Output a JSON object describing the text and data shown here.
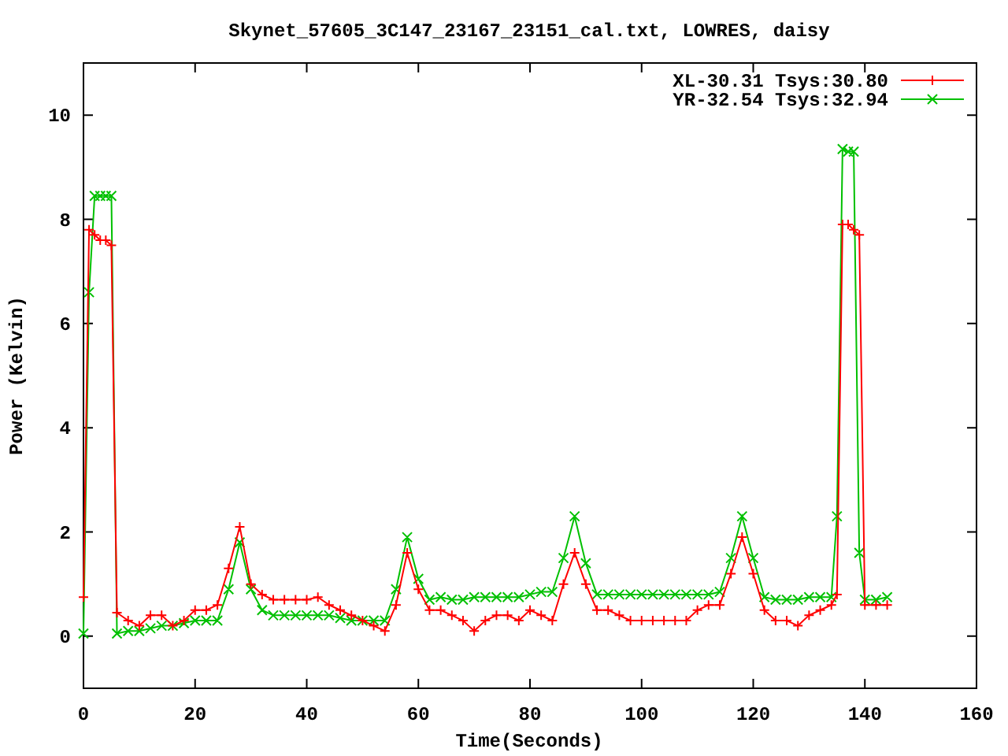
{
  "chart_data": {
    "type": "line",
    "title": "Skynet_57605_3C147_23167_23151_cal.txt, LOWRES, daisy",
    "xlabel": "Time(Seconds)",
    "ylabel": "Power (Kelvin)",
    "x": [
      0,
      1,
      2,
      3,
      4,
      5,
      6,
      8,
      10,
      12,
      14,
      16,
      18,
      20,
      22,
      24,
      26,
      28,
      30,
      32,
      34,
      36,
      38,
      40,
      42,
      44,
      46,
      48,
      50,
      52,
      54,
      56,
      58,
      60,
      62,
      64,
      66,
      68,
      70,
      72,
      74,
      76,
      78,
      80,
      82,
      84,
      86,
      88,
      90,
      92,
      94,
      96,
      98,
      100,
      102,
      104,
      106,
      108,
      110,
      112,
      114,
      116,
      118,
      120,
      122,
      124,
      126,
      128,
      130,
      132,
      134,
      135,
      136,
      137,
      138,
      139,
      140,
      142,
      144
    ],
    "series": [
      {
        "name": "XL-30.31 Tsys:30.80",
        "color": "#ff0000",
        "marker": "plus",
        "values": [
          0.75,
          7.8,
          7.7,
          7.6,
          7.6,
          7.5,
          0.45,
          0.3,
          0.2,
          0.4,
          0.4,
          0.2,
          0.3,
          0.5,
          0.5,
          0.6,
          1.3,
          2.1,
          1.0,
          0.8,
          0.7,
          0.7,
          0.7,
          0.7,
          0.75,
          0.6,
          0.5,
          0.4,
          0.3,
          0.2,
          0.1,
          0.6,
          1.6,
          0.9,
          0.5,
          0.5,
          0.4,
          0.3,
          0.1,
          0.3,
          0.4,
          0.4,
          0.3,
          0.5,
          0.4,
          0.3,
          1.0,
          1.6,
          1.0,
          0.5,
          0.5,
          0.4,
          0.3,
          0.3,
          0.3,
          0.3,
          0.3,
          0.3,
          0.5,
          0.6,
          0.6,
          1.2,
          1.9,
          1.2,
          0.5,
          0.3,
          0.3,
          0.2,
          0.4,
          0.5,
          0.6,
          0.8,
          7.9,
          7.9,
          7.8,
          7.7,
          0.6,
          0.6,
          0.6
        ]
      },
      {
        "name": "YR-32.54 Tsys:32.94",
        "color": "#00c000",
        "marker": "cross",
        "values": [
          0.05,
          6.6,
          8.45,
          8.45,
          8.45,
          8.45,
          0.05,
          0.1,
          0.1,
          0.15,
          0.2,
          0.2,
          0.25,
          0.3,
          0.3,
          0.3,
          0.9,
          1.8,
          0.9,
          0.5,
          0.4,
          0.4,
          0.4,
          0.4,
          0.4,
          0.4,
          0.35,
          0.3,
          0.3,
          0.3,
          0.3,
          0.9,
          1.9,
          1.1,
          0.7,
          0.75,
          0.7,
          0.7,
          0.75,
          0.75,
          0.75,
          0.75,
          0.75,
          0.8,
          0.85,
          0.85,
          1.5,
          2.3,
          1.4,
          0.8,
          0.8,
          0.8,
          0.8,
          0.8,
          0.8,
          0.8,
          0.8,
          0.8,
          0.8,
          0.8,
          0.85,
          1.5,
          2.3,
          1.5,
          0.75,
          0.7,
          0.7,
          0.7,
          0.75,
          0.75,
          0.75,
          2.3,
          9.35,
          9.3,
          9.3,
          1.6,
          0.7,
          0.7,
          0.75
        ]
      }
    ],
    "legend": true,
    "xlim": [
      0,
      160
    ],
    "ylim": [
      -1,
      11
    ],
    "xticks": [
      0,
      20,
      40,
      60,
      80,
      100,
      120,
      140,
      160
    ],
    "yticks": [
      0,
      2,
      4,
      6,
      8,
      10
    ]
  }
}
